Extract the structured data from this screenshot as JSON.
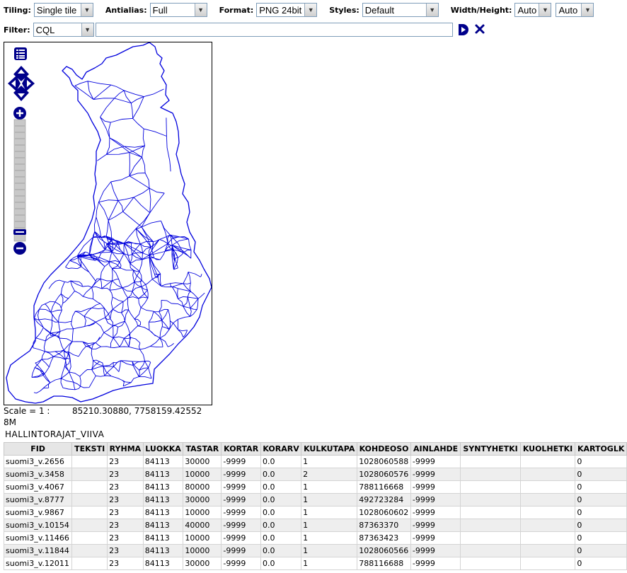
{
  "toolbar": {
    "tiling": {
      "label": "Tiling:",
      "value": "Single tile"
    },
    "antialias": {
      "label": "Antialias:",
      "value": "Full"
    },
    "format": {
      "label": "Format:",
      "value": "PNG 24bit"
    },
    "styles": {
      "label": "Styles:",
      "value": "Default"
    },
    "size": {
      "label": "Width/Height:",
      "width": "Auto",
      "height": "Auto"
    },
    "filter": {
      "label": "Filter:",
      "type": "CQL",
      "value": ""
    }
  },
  "map": {
    "scale_label": "Scale = 1 :",
    "scale_value": "8M",
    "coordinates": "85210.30880, 7758159.42552",
    "line_color": "#0000dd",
    "control_color": "#00008b"
  },
  "layer": {
    "name": "HALLINTORAJAT_VIIVA",
    "columns": [
      "FID",
      "TEKSTI",
      "RYHMA",
      "LUOKKA",
      "TASTAR",
      "KORTAR",
      "KORARV",
      "KULKUTAPA",
      "KOHDEOSO",
      "AINLAHDE",
      "SYNTYHETKI",
      "KUOLHETKI",
      "KARTOGLK"
    ],
    "rows": [
      [
        "suomi3_v.2656",
        "",
        "23",
        "84113",
        "30000",
        "-9999",
        "0.0",
        "1",
        "1028060588",
        "-9999",
        "",
        "",
        "0"
      ],
      [
        "suomi3_v.3458",
        "",
        "23",
        "84113",
        "10000",
        "-9999",
        "0.0",
        "2",
        "1028060576",
        "-9999",
        "",
        "",
        "0"
      ],
      [
        "suomi3_v.4067",
        "",
        "23",
        "84113",
        "80000",
        "-9999",
        "0.0",
        "1",
        "788116668",
        "-9999",
        "",
        "",
        "0"
      ],
      [
        "suomi3_v.8777",
        "",
        "23",
        "84113",
        "30000",
        "-9999",
        "0.0",
        "1",
        "492723284",
        "-9999",
        "",
        "",
        "0"
      ],
      [
        "suomi3_v.9867",
        "",
        "23",
        "84113",
        "10000",
        "-9999",
        "0.0",
        "1",
        "1028060602",
        "-9999",
        "",
        "",
        "0"
      ],
      [
        "suomi3_v.10154",
        "",
        "23",
        "84113",
        "40000",
        "-9999",
        "0.0",
        "1",
        "87363370",
        "-9999",
        "",
        "",
        "0"
      ],
      [
        "suomi3_v.11466",
        "",
        "23",
        "84113",
        "10000",
        "-9999",
        "0.0",
        "1",
        "87363423",
        "-9999",
        "",
        "",
        "0"
      ],
      [
        "suomi3_v.11844",
        "",
        "23",
        "84113",
        "10000",
        "-9999",
        "0.0",
        "1",
        "1028060566",
        "-9999",
        "",
        "",
        "0"
      ],
      [
        "suomi3_v.12011",
        "",
        "23",
        "84113",
        "30000",
        "-9999",
        "0.0",
        "1",
        "788116688",
        "-9999",
        "",
        "",
        "0"
      ]
    ]
  }
}
